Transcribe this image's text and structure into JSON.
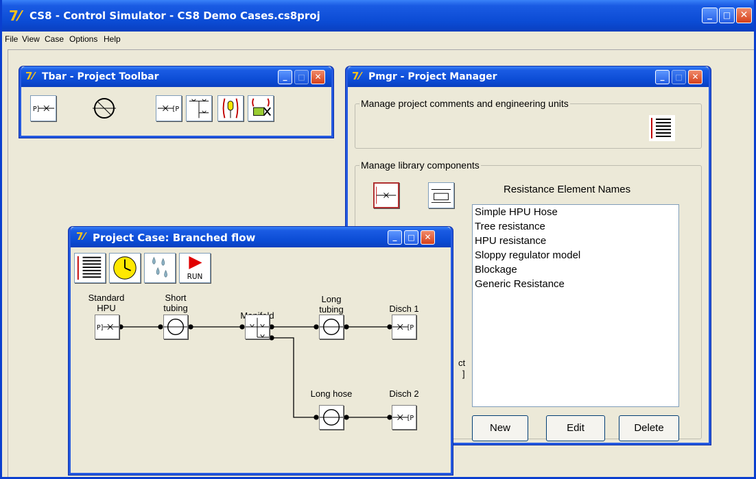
{
  "app": {
    "title": "CS8 - Control Simulator - CS8 Demo Cases.cs8proj",
    "menu": [
      "File",
      "View",
      "Case",
      "Options",
      "Help"
    ]
  },
  "toolbar_window": {
    "title": "Tbar - Project Toolbar",
    "tools": [
      "source-pressure-icon",
      "resistance-circle-icon",
      "discharge-pressure-icon",
      "manifold-icon",
      "valve-icon",
      "actuator-icon"
    ]
  },
  "project_manager": {
    "title": "Pmgr - Project Manager",
    "comments_group_label": "Manage project comments and engineering units",
    "library_group_label": "Manage library components",
    "list_title": "Resistance Element Names",
    "list_items": [
      "Simple HPU Hose",
      "Tree resistance",
      "HPU resistance",
      "Sloppy regulator model",
      "Blockage",
      "Generic Resistance"
    ],
    "partial_text_1": "ct",
    "partial_text_2": "]",
    "buttons": {
      "new": "New",
      "edit": "Edit",
      "delete": "Delete"
    }
  },
  "case_window": {
    "title": "Project Case: Branched flow",
    "run_label": "RUN",
    "components": [
      {
        "label": "Standard\nHPU"
      },
      {
        "label": "Short\ntubing"
      },
      {
        "label": "Manifold"
      },
      {
        "label": "Long\ntubing"
      },
      {
        "label": "Disch 1"
      },
      {
        "label": "Long hose"
      },
      {
        "label": "Disch 2"
      }
    ]
  },
  "colors": {
    "titlebar": "#0b4bd4",
    "window_bg": "#ece9d8",
    "close_button": "#d6401a",
    "run_red": "#e00000",
    "clock_yellow": "#ffe800"
  }
}
